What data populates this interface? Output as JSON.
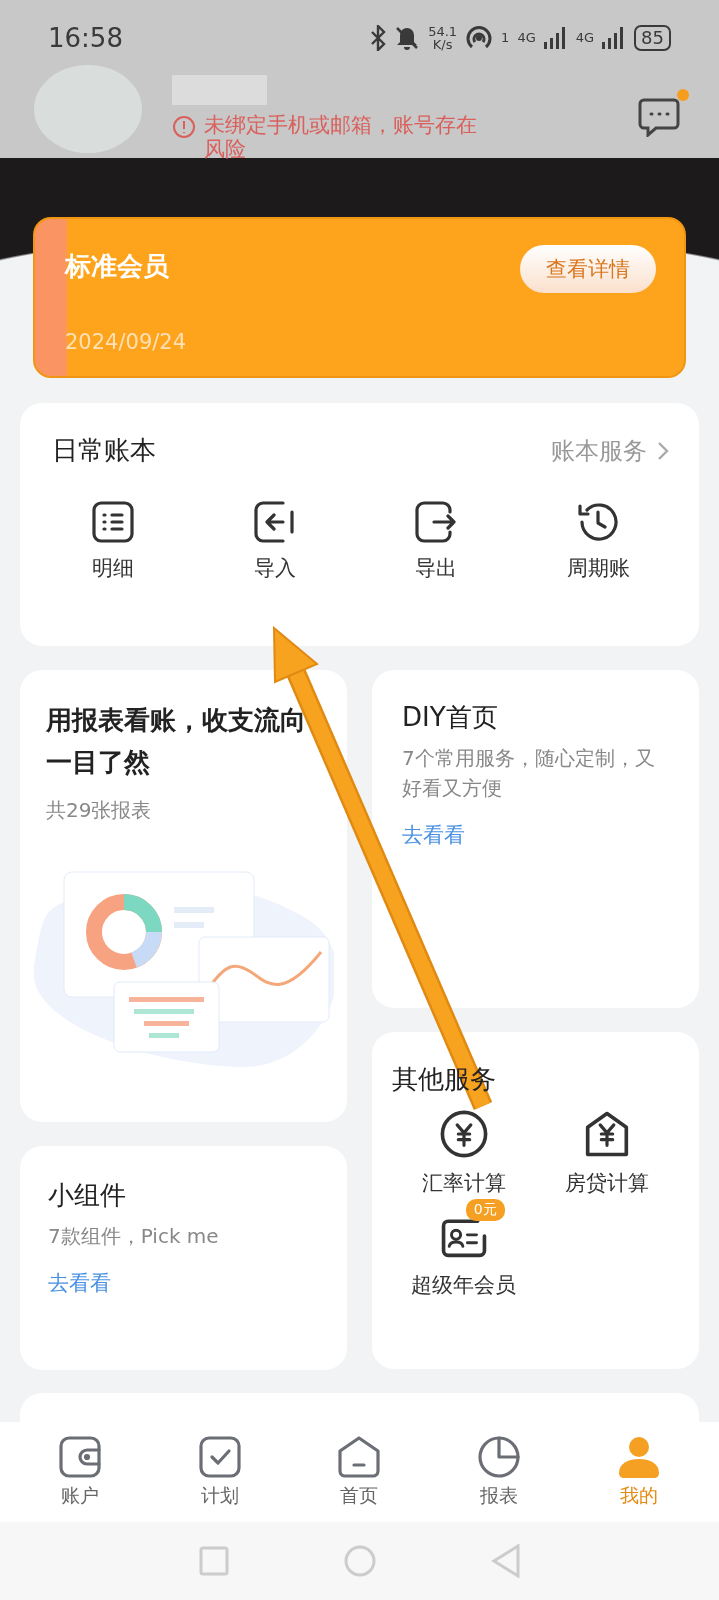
{
  "status_bar": {
    "time": "16:58",
    "speed_value": "54.1",
    "speed_unit": "K/s",
    "hotspot_count": "1",
    "networks": [
      "4G",
      "4G"
    ],
    "battery": "85"
  },
  "profile": {
    "warning": "未绑定手机或邮箱，账号存在风险",
    "messages_unread": true
  },
  "membership": {
    "title": "标准会员",
    "date": "2024/09/24",
    "button": "查看详情"
  },
  "ledger": {
    "title": "日常账本",
    "link": "账本服务",
    "items": [
      {
        "label": "明细",
        "kind": "list"
      },
      {
        "label": "导入",
        "kind": "import"
      },
      {
        "label": "导出",
        "kind": "export"
      },
      {
        "label": "周期账",
        "kind": "cycle"
      }
    ]
  },
  "report_card": {
    "title": "用报表看账，收支流向一目了然",
    "subtitle": "共29张报表"
  },
  "diy_card": {
    "title": "DIY首页",
    "description": "7个常用服务，随心定制，又好看又方便",
    "link": "去看看"
  },
  "other_services": {
    "title": "其他服务",
    "items": [
      {
        "label": "汇率计算",
        "kind": "exchange"
      },
      {
        "label": "房贷计算",
        "kind": "mortgage"
      },
      {
        "label": "超级年会员",
        "kind": "vip",
        "badge": "0元"
      }
    ]
  },
  "widget_card": {
    "title": "小组件",
    "description": "7款组件，Pick me",
    "link": "去看看"
  },
  "tab_bar": [
    {
      "label": "账户",
      "kind": "wallet",
      "selected": false
    },
    {
      "label": "计划",
      "kind": "plan",
      "selected": false
    },
    {
      "label": "首页",
      "kind": "home",
      "selected": false
    },
    {
      "label": "报表",
      "kind": "report",
      "selected": false
    },
    {
      "label": "我的",
      "kind": "me",
      "selected": true
    }
  ]
}
